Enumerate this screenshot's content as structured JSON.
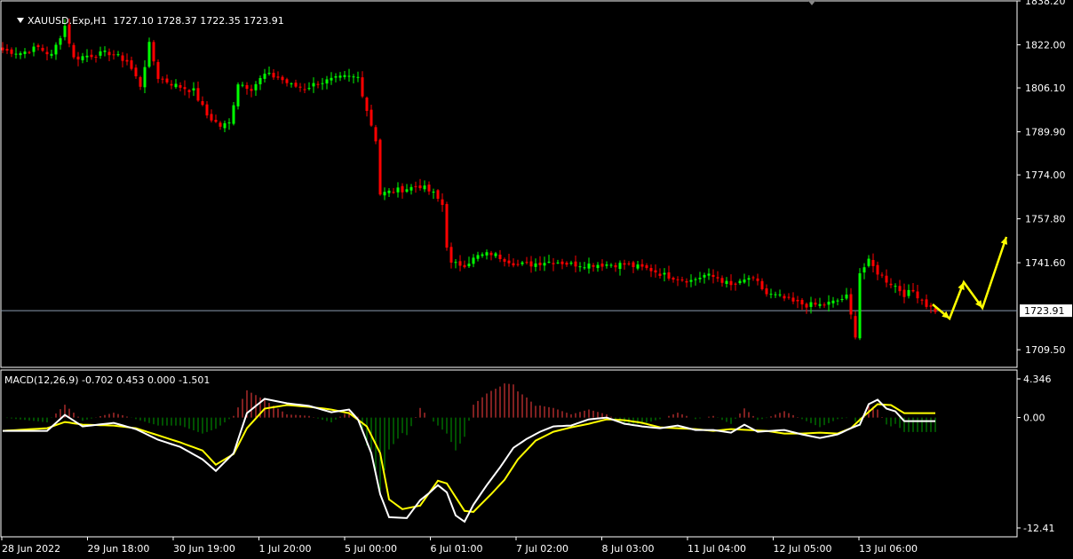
{
  "header": {
    "symbol": "XAUUSD.Exp,H1",
    "ohlc": "1727.10 1728.37 1722.35 1723.91"
  },
  "macd_panel": {
    "label": "MACD(12,26,9) -0.702 0.453 0.000 -1.501"
  },
  "colors": {
    "background": "#000000",
    "bull_candle": "#00ff00",
    "bear_candle": "#ff0000",
    "grid_border": "#ffffff",
    "price_line": "#8a9bb0",
    "macd_line": "#ffffff",
    "signal_line": "#ffff00",
    "hist_positive": "#ff4040",
    "hist_negative": "#00a000",
    "forecast_arrow": "#ffff00"
  },
  "chart_data": [
    {
      "type": "candlestick",
      "title": "XAUUSD.Exp,H1",
      "y_ticks": [
        "1838.20",
        "1822.00",
        "1806.10",
        "1789.90",
        "1774.00",
        "1757.80",
        "1741.60",
        "1709.50"
      ],
      "ylim": [
        1703,
        1838.2
      ],
      "current_price": "1723.91",
      "x_tick_labels": [
        "28 Jun 2022",
        "29 Jun 18:00",
        "30 Jun 19:00",
        "1 Jul 20:00",
        "5 Jul 00:00",
        "6 Jul 01:00",
        "7 Jul 02:00",
        "8 Jul 03:00",
        "11 Jul 04:00",
        "12 Jul 05:00",
        "13 Jul 06:00"
      ],
      "close_path": [
        [
          0,
          1820
        ],
        [
          4,
          1819
        ],
        [
          8,
          1821
        ],
        [
          11,
          1818
        ],
        [
          14,
          1829
        ],
        [
          16,
          1817
        ],
        [
          19,
          1818
        ],
        [
          24,
          1819
        ],
        [
          28,
          1816
        ],
        [
          31,
          1807
        ],
        [
          33,
          1822
        ],
        [
          35,
          1810
        ],
        [
          39,
          1807
        ],
        [
          43,
          1805
        ],
        [
          46,
          1796
        ],
        [
          49,
          1792
        ],
        [
          51,
          1793
        ],
        [
          53,
          1808
        ],
        [
          56,
          1806
        ],
        [
          59,
          1811
        ],
        [
          62,
          1810
        ],
        [
          65,
          1807
        ],
        [
          68,
          1806
        ],
        [
          71,
          1808
        ],
        [
          74,
          1809
        ],
        [
          77,
          1810
        ],
        [
          80,
          1810
        ],
        [
          82,
          1798
        ],
        [
          84,
          1787
        ],
        [
          85,
          1767
        ],
        [
          88,
          1768
        ],
        [
          91,
          1769
        ],
        [
          94,
          1770
        ],
        [
          97,
          1767
        ],
        [
          99,
          1763
        ],
        [
          100,
          1748
        ],
        [
          101,
          1741
        ],
        [
          104,
          1741
        ],
        [
          107,
          1744
        ],
        [
          110,
          1745
        ],
        [
          113,
          1743
        ],
        [
          116,
          1741
        ],
        [
          119,
          1741
        ],
        [
          122,
          1742
        ],
        [
          125,
          1742
        ],
        [
          128,
          1741
        ],
        [
          131,
          1741
        ],
        [
          134,
          1741
        ],
        [
          137,
          1741
        ],
        [
          140,
          1741
        ],
        [
          143,
          1740
        ],
        [
          146,
          1739
        ],
        [
          149,
          1737
        ],
        [
          152,
          1736
        ],
        [
          155,
          1735
        ],
        [
          158,
          1737
        ],
        [
          161,
          1736
        ],
        [
          164,
          1733
        ],
        [
          166,
          1734
        ],
        [
          168,
          1736
        ],
        [
          170,
          1734
        ],
        [
          172,
          1730
        ],
        [
          175,
          1729
        ],
        [
          178,
          1727
        ],
        [
          181,
          1726
        ],
        [
          184,
          1726
        ],
        [
          187,
          1727
        ],
        [
          190,
          1729
        ],
        [
          192,
          1715
        ],
        [
          193,
          1738
        ],
        [
          195,
          1742
        ],
        [
          197,
          1738
        ],
        [
          199,
          1735
        ],
        [
          201,
          1733
        ],
        [
          203,
          1730
        ],
        [
          205,
          1731
        ],
        [
          207,
          1728
        ],
        [
          208,
          1726
        ],
        [
          210,
          1724
        ]
      ],
      "forecast_path": [
        [
          1723,
          1718
        ],
        [
          1730,
          1735
        ],
        [
          1737,
          1725
        ],
        [
          1750,
          1752
        ]
      ]
    },
    {
      "type": "line",
      "title": "MACD(12,26,9) -0.702 0.453 0.000 -1.501",
      "y_ticks": [
        "4.346",
        "0.00",
        "-12.41"
      ],
      "ylim": [
        -12.41,
        4.346
      ],
      "series": [
        {
          "name": "MACD",
          "points": [
            [
              0,
              -1.5
            ],
            [
              10,
              -1.5
            ],
            [
              14,
              0.3
            ],
            [
              18,
              -1.0
            ],
            [
              25,
              -0.6
            ],
            [
              30,
              -1.3
            ],
            [
              35,
              -2.5
            ],
            [
              40,
              -3.3
            ],
            [
              45,
              -4.7
            ],
            [
              48,
              -6.0
            ],
            [
              52,
              -4.0
            ],
            [
              55,
              0.5
            ],
            [
              59,
              2.1
            ],
            [
              64,
              1.6
            ],
            [
              69,
              1.3
            ],
            [
              74,
              0.6
            ],
            [
              78,
              0.9
            ],
            [
              80,
              -0.2
            ],
            [
              83,
              -4.0
            ],
            [
              85,
              -8.6
            ],
            [
              87,
              -11.2
            ],
            [
              91,
              -11.3
            ],
            [
              94,
              -9.3
            ],
            [
              96,
              -8.5
            ],
            [
              98,
              -7.6
            ],
            [
              100,
              -8.4
            ],
            [
              102,
              -11.0
            ],
            [
              104,
              -11.7
            ],
            [
              106,
              -9.8
            ],
            [
              109,
              -7.6
            ],
            [
              112,
              -5.6
            ],
            [
              115,
              -3.4
            ],
            [
              118,
              -2.4
            ],
            [
              121,
              -1.6
            ],
            [
              124,
              -1.0
            ],
            [
              128,
              -0.9
            ],
            [
              132,
              -0.2
            ],
            [
              136,
              0.0
            ],
            [
              140,
              -0.7
            ],
            [
              144,
              -1.0
            ],
            [
              148,
              -1.2
            ],
            [
              152,
              -0.9
            ],
            [
              156,
              -1.4
            ],
            [
              160,
              -1.4
            ],
            [
              164,
              -1.7
            ],
            [
              167,
              -0.8
            ],
            [
              170,
              -1.6
            ],
            [
              173,
              -1.5
            ],
            [
              176,
              -1.4
            ],
            [
              180,
              -1.9
            ],
            [
              184,
              -2.3
            ],
            [
              188,
              -1.9
            ],
            [
              191,
              -1.2
            ],
            [
              193,
              -0.8
            ],
            [
              195,
              1.5
            ],
            [
              197,
              2.0
            ],
            [
              199,
              1.0
            ],
            [
              201,
              0.7
            ],
            [
              203,
              -0.4
            ]
          ]
        },
        {
          "name": "Signal",
          "points": [
            [
              0,
              -1.5
            ],
            [
              10,
              -1.2
            ],
            [
              14,
              -0.5
            ],
            [
              18,
              -0.8
            ],
            [
              25,
              -0.9
            ],
            [
              30,
              -1.2
            ],
            [
              35,
              -2.0
            ],
            [
              40,
              -2.8
            ],
            [
              45,
              -3.7
            ],
            [
              48,
              -5.3
            ],
            [
              52,
              -4.1
            ],
            [
              55,
              -1.2
            ],
            [
              59,
              1.0
            ],
            [
              64,
              1.4
            ],
            [
              69,
              1.2
            ],
            [
              74,
              0.9
            ],
            [
              78,
              0.5
            ],
            [
              82,
              -1.0
            ],
            [
              85,
              -4.0
            ],
            [
              87,
              -9.2
            ],
            [
              90,
              -10.3
            ],
            [
              94,
              -9.9
            ],
            [
              98,
              -7.1
            ],
            [
              100,
              -7.4
            ],
            [
              104,
              -10.5
            ],
            [
              106,
              -10.6
            ],
            [
              110,
              -8.6
            ],
            [
              113,
              -7.0
            ],
            [
              116,
              -4.7
            ],
            [
              120,
              -2.6
            ],
            [
              124,
              -1.6
            ],
            [
              128,
              -1.1
            ],
            [
              132,
              -0.7
            ],
            [
              136,
              -0.2
            ],
            [
              140,
              -0.3
            ],
            [
              144,
              -0.6
            ],
            [
              148,
              -1.1
            ],
            [
              152,
              -1.2
            ],
            [
              156,
              -1.3
            ],
            [
              160,
              -1.5
            ],
            [
              164,
              -1.3
            ],
            [
              168,
              -1.4
            ],
            [
              172,
              -1.5
            ],
            [
              176,
              -1.8
            ],
            [
              180,
              -1.8
            ],
            [
              184,
              -1.7
            ],
            [
              188,
              -1.8
            ],
            [
              191,
              -1.2
            ],
            [
              194,
              0.2
            ],
            [
              197,
              1.5
            ],
            [
              200,
              1.4
            ],
            [
              203,
              0.5
            ]
          ]
        }
      ]
    }
  ]
}
